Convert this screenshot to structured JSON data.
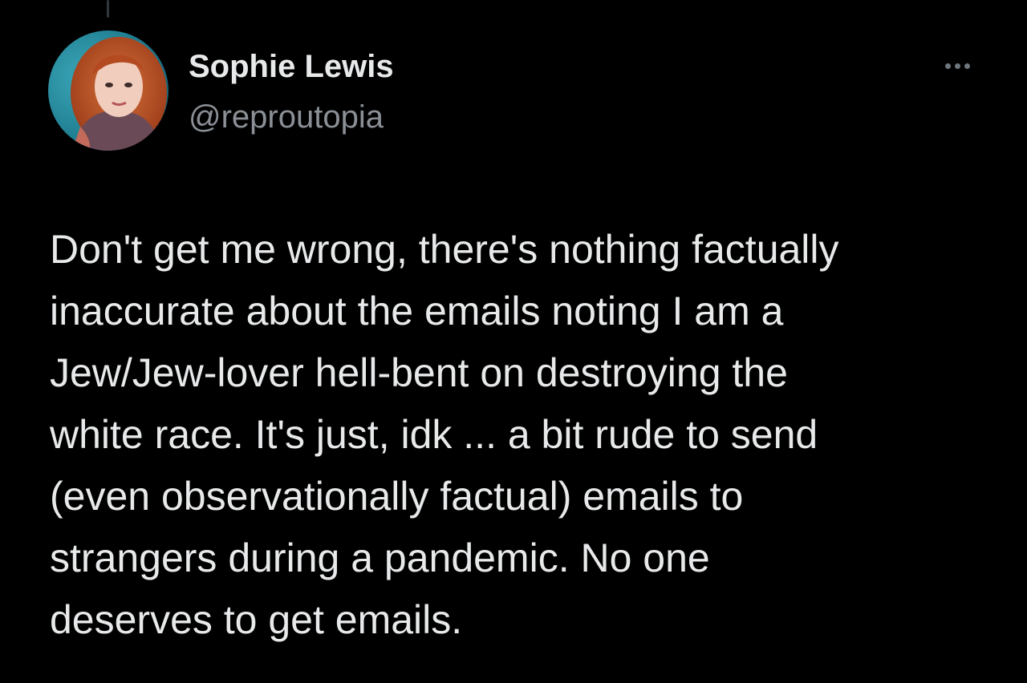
{
  "tweet": {
    "author": {
      "name": "Sophie Lewis",
      "handle": "@reproutopia",
      "avatar_icon": "profile-photo"
    },
    "more_icon": "ellipsis-horizontal-icon",
    "text_lines": [
      "Don't get me wrong, there's nothing factually",
      "inaccurate about the emails noting I am a",
      "Jew/Jew-lover hell-bent on destroying the",
      "white race. It's just, idk ... a bit rude to send",
      "(even observationally factual) emails to",
      "strangers during a pandemic. No one",
      "deserves to get emails."
    ]
  },
  "colors": {
    "background": "#000000",
    "primary_text": "#e7e9ea",
    "secondary_text": "#8b9096",
    "icon_gray": "#6e767d"
  }
}
